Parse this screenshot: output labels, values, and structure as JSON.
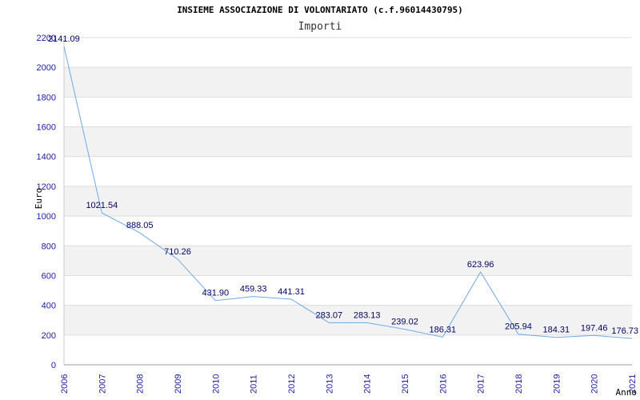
{
  "chart_data": {
    "type": "line",
    "title": "INSIEME ASSOCIAZIONE DI VOLONTARIATO (c.f.96014430795)",
    "subtitle": "Importi",
    "xlabel": "Anno",
    "ylabel": "Euro",
    "ylim": [
      0,
      2200
    ],
    "yticks": [
      "0",
      "200",
      "400",
      "600",
      "800",
      "1000",
      "1200",
      "1400",
      "1600",
      "1800",
      "2000",
      "2200"
    ],
    "categories": [
      "2006",
      "2007",
      "2008",
      "2009",
      "2010",
      "2011",
      "2012",
      "2013",
      "2014",
      "2015",
      "2016",
      "2017",
      "2018",
      "2019",
      "2020",
      "2021"
    ],
    "values": [
      2141.09,
      1021.54,
      888.05,
      710.26,
      431.9,
      459.33,
      441.31,
      283.07,
      283.13,
      239.02,
      186.31,
      623.96,
      205.94,
      184.31,
      197.46,
      176.73
    ],
    "value_labels": [
      "2141.09",
      "1021.54",
      "888.05",
      "710.26",
      "431.90",
      "459.33",
      "441.31",
      "283.07",
      "283.13",
      "239.02",
      "186.31",
      "623.96",
      "205.94",
      "184.31",
      "197.46",
      "176.73"
    ],
    "grid": true,
    "colors": {
      "line": "#6fa8e8",
      "band": "#f2f2f2",
      "gridline": "#dddddd",
      "ticks": "#1a1aa6",
      "labels": "#000066"
    }
  }
}
